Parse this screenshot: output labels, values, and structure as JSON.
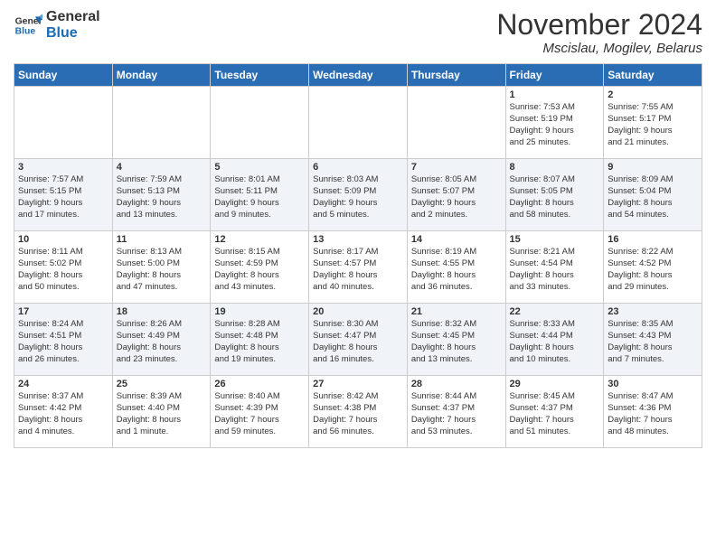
{
  "logo": {
    "line1": "General",
    "line2": "Blue"
  },
  "title": "November 2024",
  "subtitle": "Mscislau, Mogilev, Belarus",
  "weekdays": [
    "Sunday",
    "Monday",
    "Tuesday",
    "Wednesday",
    "Thursday",
    "Friday",
    "Saturday"
  ],
  "weeks": [
    [
      {
        "day": "",
        "info": ""
      },
      {
        "day": "",
        "info": ""
      },
      {
        "day": "",
        "info": ""
      },
      {
        "day": "",
        "info": ""
      },
      {
        "day": "",
        "info": ""
      },
      {
        "day": "1",
        "info": "Sunrise: 7:53 AM\nSunset: 5:19 PM\nDaylight: 9 hours\nand 25 minutes."
      },
      {
        "day": "2",
        "info": "Sunrise: 7:55 AM\nSunset: 5:17 PM\nDaylight: 9 hours\nand 21 minutes."
      }
    ],
    [
      {
        "day": "3",
        "info": "Sunrise: 7:57 AM\nSunset: 5:15 PM\nDaylight: 9 hours\nand 17 minutes."
      },
      {
        "day": "4",
        "info": "Sunrise: 7:59 AM\nSunset: 5:13 PM\nDaylight: 9 hours\nand 13 minutes."
      },
      {
        "day": "5",
        "info": "Sunrise: 8:01 AM\nSunset: 5:11 PM\nDaylight: 9 hours\nand 9 minutes."
      },
      {
        "day": "6",
        "info": "Sunrise: 8:03 AM\nSunset: 5:09 PM\nDaylight: 9 hours\nand 5 minutes."
      },
      {
        "day": "7",
        "info": "Sunrise: 8:05 AM\nSunset: 5:07 PM\nDaylight: 9 hours\nand 2 minutes."
      },
      {
        "day": "8",
        "info": "Sunrise: 8:07 AM\nSunset: 5:05 PM\nDaylight: 8 hours\nand 58 minutes."
      },
      {
        "day": "9",
        "info": "Sunrise: 8:09 AM\nSunset: 5:04 PM\nDaylight: 8 hours\nand 54 minutes."
      }
    ],
    [
      {
        "day": "10",
        "info": "Sunrise: 8:11 AM\nSunset: 5:02 PM\nDaylight: 8 hours\nand 50 minutes."
      },
      {
        "day": "11",
        "info": "Sunrise: 8:13 AM\nSunset: 5:00 PM\nDaylight: 8 hours\nand 47 minutes."
      },
      {
        "day": "12",
        "info": "Sunrise: 8:15 AM\nSunset: 4:59 PM\nDaylight: 8 hours\nand 43 minutes."
      },
      {
        "day": "13",
        "info": "Sunrise: 8:17 AM\nSunset: 4:57 PM\nDaylight: 8 hours\nand 40 minutes."
      },
      {
        "day": "14",
        "info": "Sunrise: 8:19 AM\nSunset: 4:55 PM\nDaylight: 8 hours\nand 36 minutes."
      },
      {
        "day": "15",
        "info": "Sunrise: 8:21 AM\nSunset: 4:54 PM\nDaylight: 8 hours\nand 33 minutes."
      },
      {
        "day": "16",
        "info": "Sunrise: 8:22 AM\nSunset: 4:52 PM\nDaylight: 8 hours\nand 29 minutes."
      }
    ],
    [
      {
        "day": "17",
        "info": "Sunrise: 8:24 AM\nSunset: 4:51 PM\nDaylight: 8 hours\nand 26 minutes."
      },
      {
        "day": "18",
        "info": "Sunrise: 8:26 AM\nSunset: 4:49 PM\nDaylight: 8 hours\nand 23 minutes."
      },
      {
        "day": "19",
        "info": "Sunrise: 8:28 AM\nSunset: 4:48 PM\nDaylight: 8 hours\nand 19 minutes."
      },
      {
        "day": "20",
        "info": "Sunrise: 8:30 AM\nSunset: 4:47 PM\nDaylight: 8 hours\nand 16 minutes."
      },
      {
        "day": "21",
        "info": "Sunrise: 8:32 AM\nSunset: 4:45 PM\nDaylight: 8 hours\nand 13 minutes."
      },
      {
        "day": "22",
        "info": "Sunrise: 8:33 AM\nSunset: 4:44 PM\nDaylight: 8 hours\nand 10 minutes."
      },
      {
        "day": "23",
        "info": "Sunrise: 8:35 AM\nSunset: 4:43 PM\nDaylight: 8 hours\nand 7 minutes."
      }
    ],
    [
      {
        "day": "24",
        "info": "Sunrise: 8:37 AM\nSunset: 4:42 PM\nDaylight: 8 hours\nand 4 minutes."
      },
      {
        "day": "25",
        "info": "Sunrise: 8:39 AM\nSunset: 4:40 PM\nDaylight: 8 hours\nand 1 minute."
      },
      {
        "day": "26",
        "info": "Sunrise: 8:40 AM\nSunset: 4:39 PM\nDaylight: 7 hours\nand 59 minutes."
      },
      {
        "day": "27",
        "info": "Sunrise: 8:42 AM\nSunset: 4:38 PM\nDaylight: 7 hours\nand 56 minutes."
      },
      {
        "day": "28",
        "info": "Sunrise: 8:44 AM\nSunset: 4:37 PM\nDaylight: 7 hours\nand 53 minutes."
      },
      {
        "day": "29",
        "info": "Sunrise: 8:45 AM\nSunset: 4:37 PM\nDaylight: 7 hours\nand 51 minutes."
      },
      {
        "day": "30",
        "info": "Sunrise: 8:47 AM\nSunset: 4:36 PM\nDaylight: 7 hours\nand 48 minutes."
      }
    ]
  ]
}
